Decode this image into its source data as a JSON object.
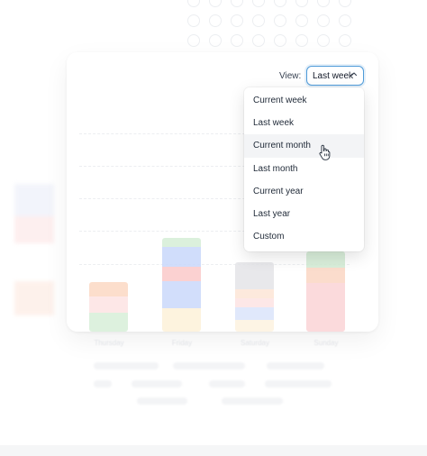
{
  "filter": {
    "label": "View:",
    "selected": "Last week"
  },
  "menu": {
    "items": [
      {
        "label": "Current week"
      },
      {
        "label": "Last week"
      },
      {
        "label": "Current month"
      },
      {
        "label": "Last month"
      },
      {
        "label": "Current year"
      },
      {
        "label": "Last year"
      },
      {
        "label": "Custom"
      }
    ],
    "hovered": "Current month"
  },
  "chart": {
    "days": [
      "Thursday",
      "Friday",
      "Saturday",
      "Sunday"
    ]
  },
  "colors": {
    "accent": "#4f9bd9",
    "hover_bg": "#f3f4f6"
  }
}
